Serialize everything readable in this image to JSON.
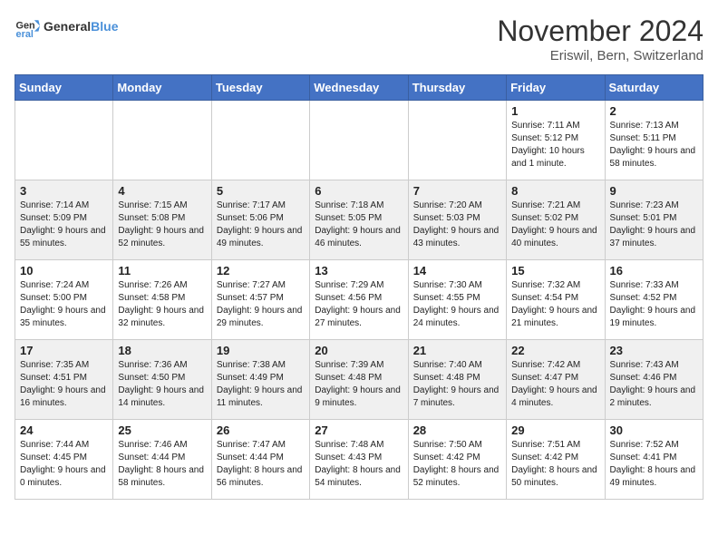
{
  "header": {
    "logo_general": "General",
    "logo_blue": "Blue",
    "month_title": "November 2024",
    "subtitle": "Eriswil, Bern, Switzerland"
  },
  "weekdays": [
    "Sunday",
    "Monday",
    "Tuesday",
    "Wednesday",
    "Thursday",
    "Friday",
    "Saturday"
  ],
  "rows": [
    {
      "cells": [
        {
          "empty": true
        },
        {
          "empty": true
        },
        {
          "empty": true
        },
        {
          "empty": true
        },
        {
          "empty": true
        },
        {
          "day": "1",
          "sunrise": "Sunrise: 7:11 AM",
          "sunset": "Sunset: 5:12 PM",
          "daylight": "Daylight: 10 hours and 1 minute."
        },
        {
          "day": "2",
          "sunrise": "Sunrise: 7:13 AM",
          "sunset": "Sunset: 5:11 PM",
          "daylight": "Daylight: 9 hours and 58 minutes."
        }
      ]
    },
    {
      "cells": [
        {
          "day": "3",
          "sunrise": "Sunrise: 7:14 AM",
          "sunset": "Sunset: 5:09 PM",
          "daylight": "Daylight: 9 hours and 55 minutes."
        },
        {
          "day": "4",
          "sunrise": "Sunrise: 7:15 AM",
          "sunset": "Sunset: 5:08 PM",
          "daylight": "Daylight: 9 hours and 52 minutes."
        },
        {
          "day": "5",
          "sunrise": "Sunrise: 7:17 AM",
          "sunset": "Sunset: 5:06 PM",
          "daylight": "Daylight: 9 hours and 49 minutes."
        },
        {
          "day": "6",
          "sunrise": "Sunrise: 7:18 AM",
          "sunset": "Sunset: 5:05 PM",
          "daylight": "Daylight: 9 hours and 46 minutes."
        },
        {
          "day": "7",
          "sunrise": "Sunrise: 7:20 AM",
          "sunset": "Sunset: 5:03 PM",
          "daylight": "Daylight: 9 hours and 43 minutes."
        },
        {
          "day": "8",
          "sunrise": "Sunrise: 7:21 AM",
          "sunset": "Sunset: 5:02 PM",
          "daylight": "Daylight: 9 hours and 40 minutes."
        },
        {
          "day": "9",
          "sunrise": "Sunrise: 7:23 AM",
          "sunset": "Sunset: 5:01 PM",
          "daylight": "Daylight: 9 hours and 37 minutes."
        }
      ]
    },
    {
      "cells": [
        {
          "day": "10",
          "sunrise": "Sunrise: 7:24 AM",
          "sunset": "Sunset: 5:00 PM",
          "daylight": "Daylight: 9 hours and 35 minutes."
        },
        {
          "day": "11",
          "sunrise": "Sunrise: 7:26 AM",
          "sunset": "Sunset: 4:58 PM",
          "daylight": "Daylight: 9 hours and 32 minutes."
        },
        {
          "day": "12",
          "sunrise": "Sunrise: 7:27 AM",
          "sunset": "Sunset: 4:57 PM",
          "daylight": "Daylight: 9 hours and 29 minutes."
        },
        {
          "day": "13",
          "sunrise": "Sunrise: 7:29 AM",
          "sunset": "Sunset: 4:56 PM",
          "daylight": "Daylight: 9 hours and 27 minutes."
        },
        {
          "day": "14",
          "sunrise": "Sunrise: 7:30 AM",
          "sunset": "Sunset: 4:55 PM",
          "daylight": "Daylight: 9 hours and 24 minutes."
        },
        {
          "day": "15",
          "sunrise": "Sunrise: 7:32 AM",
          "sunset": "Sunset: 4:54 PM",
          "daylight": "Daylight: 9 hours and 21 minutes."
        },
        {
          "day": "16",
          "sunrise": "Sunrise: 7:33 AM",
          "sunset": "Sunset: 4:52 PM",
          "daylight": "Daylight: 9 hours and 19 minutes."
        }
      ]
    },
    {
      "cells": [
        {
          "day": "17",
          "sunrise": "Sunrise: 7:35 AM",
          "sunset": "Sunset: 4:51 PM",
          "daylight": "Daylight: 9 hours and 16 minutes."
        },
        {
          "day": "18",
          "sunrise": "Sunrise: 7:36 AM",
          "sunset": "Sunset: 4:50 PM",
          "daylight": "Daylight: 9 hours and 14 minutes."
        },
        {
          "day": "19",
          "sunrise": "Sunrise: 7:38 AM",
          "sunset": "Sunset: 4:49 PM",
          "daylight": "Daylight: 9 hours and 11 minutes."
        },
        {
          "day": "20",
          "sunrise": "Sunrise: 7:39 AM",
          "sunset": "Sunset: 4:48 PM",
          "daylight": "Daylight: 9 hours and 9 minutes."
        },
        {
          "day": "21",
          "sunrise": "Sunrise: 7:40 AM",
          "sunset": "Sunset: 4:48 PM",
          "daylight": "Daylight: 9 hours and 7 minutes."
        },
        {
          "day": "22",
          "sunrise": "Sunrise: 7:42 AM",
          "sunset": "Sunset: 4:47 PM",
          "daylight": "Daylight: 9 hours and 4 minutes."
        },
        {
          "day": "23",
          "sunrise": "Sunrise: 7:43 AM",
          "sunset": "Sunset: 4:46 PM",
          "daylight": "Daylight: 9 hours and 2 minutes."
        }
      ]
    },
    {
      "cells": [
        {
          "day": "24",
          "sunrise": "Sunrise: 7:44 AM",
          "sunset": "Sunset: 4:45 PM",
          "daylight": "Daylight: 9 hours and 0 minutes."
        },
        {
          "day": "25",
          "sunrise": "Sunrise: 7:46 AM",
          "sunset": "Sunset: 4:44 PM",
          "daylight": "Daylight: 8 hours and 58 minutes."
        },
        {
          "day": "26",
          "sunrise": "Sunrise: 7:47 AM",
          "sunset": "Sunset: 4:44 PM",
          "daylight": "Daylight: 8 hours and 56 minutes."
        },
        {
          "day": "27",
          "sunrise": "Sunrise: 7:48 AM",
          "sunset": "Sunset: 4:43 PM",
          "daylight": "Daylight: 8 hours and 54 minutes."
        },
        {
          "day": "28",
          "sunrise": "Sunrise: 7:50 AM",
          "sunset": "Sunset: 4:42 PM",
          "daylight": "Daylight: 8 hours and 52 minutes."
        },
        {
          "day": "29",
          "sunrise": "Sunrise: 7:51 AM",
          "sunset": "Sunset: 4:42 PM",
          "daylight": "Daylight: 8 hours and 50 minutes."
        },
        {
          "day": "30",
          "sunrise": "Sunrise: 7:52 AM",
          "sunset": "Sunset: 4:41 PM",
          "daylight": "Daylight: 8 hours and 49 minutes."
        }
      ]
    }
  ]
}
